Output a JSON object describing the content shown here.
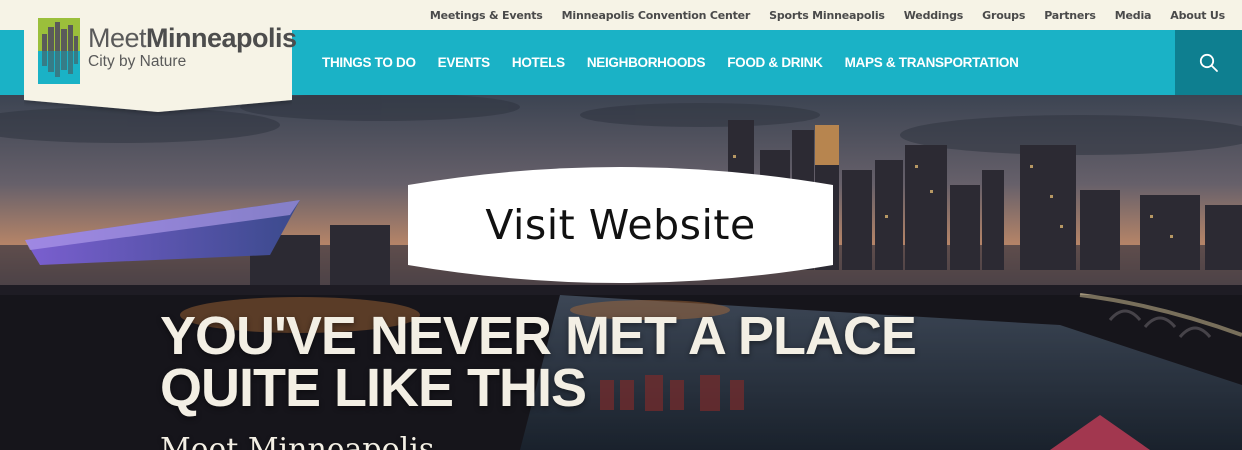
{
  "utility_nav": [
    "Meetings & Events",
    "Minneapolis Convention Center",
    "Sports Minneapolis",
    "Weddings",
    "Groups",
    "Partners",
    "Media",
    "About Us"
  ],
  "main_nav": [
    "THINGS TO DO",
    "EVENTS",
    "HOTELS",
    "NEIGHBORHOODS",
    "FOOD & DRINK",
    "MAPS & TRANSPORTATION"
  ],
  "logo": {
    "name_light": "Meet",
    "name_bold": "Minneapolis",
    "tagline": "City by Nature"
  },
  "search": {
    "icon": "search-icon"
  },
  "hero": {
    "overlay_button": "Visit Website",
    "headline_line1": "YOU'VE NEVER MET A PLACE",
    "headline_line2": "QUITE LIKE THIS",
    "subheading_partial": "Meet Minneapolis"
  },
  "colors": {
    "nav_bg": "#1ab2c6",
    "search_bg": "#0e7f90",
    "cream": "#f6f3e6",
    "headline_text": "#f3efe4"
  }
}
